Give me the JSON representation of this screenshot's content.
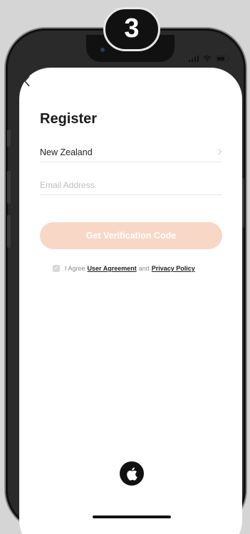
{
  "step_badge": "3",
  "screen": {
    "title": "Register",
    "country": {
      "value": "New Zealand"
    },
    "email": {
      "placeholder": "Email Address"
    },
    "verify_button": "Get Verification Code",
    "agreement": {
      "prefix": "I Agree",
      "user_agreement": "User Agreement",
      "and": "and",
      "privacy_policy": "Privacy Policy"
    },
    "icons": {
      "back": "back-chevron-icon",
      "country_chevron": "chevron-right-icon",
      "apple": "apple-logo-icon",
      "signal": "signal-icon",
      "wifi": "wifi-icon",
      "battery": "battery-icon"
    }
  },
  "colors": {
    "accent_button": "#f9d7c6",
    "phone_frame": "#2a2a2a",
    "background": "#d5d5d5"
  }
}
